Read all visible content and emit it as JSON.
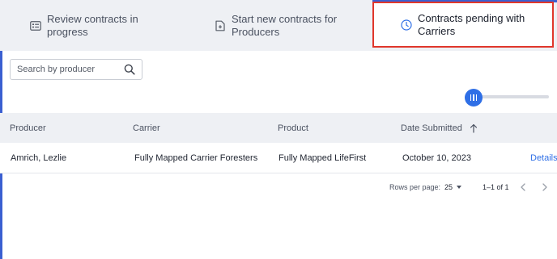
{
  "tabs": [
    {
      "label_line1": "Review contracts in",
      "label_line2": "progress",
      "icon": "list-card-icon"
    },
    {
      "label_line1": "Start new contracts for",
      "label_line2": "Producers",
      "icon": "new-document-icon"
    },
    {
      "label_line1": "Contracts pending with",
      "label_line2": "Carriers",
      "icon": "clock-icon"
    }
  ],
  "search": {
    "placeholder": "Search by producer",
    "icon": "search-icon"
  },
  "table": {
    "headers": {
      "producer": "Producer",
      "carrier": "Carrier",
      "product": "Product",
      "date": "Date Submitted"
    },
    "rows": [
      {
        "producer": "Amrich, Lezlie",
        "carrier": "Fully Mapped Carrier Foresters",
        "product": "Fully Mapped LifeFirst",
        "date": "October 10, 2023",
        "action": "Details"
      }
    ]
  },
  "pagination": {
    "rows_per_page_label": "Rows per page:",
    "rows_per_page_value": "25",
    "range": "1–1 of 1"
  },
  "colors": {
    "accent": "#2f6fe6",
    "highlight_border": "#e0362b",
    "header_bg": "#eef0f4"
  }
}
